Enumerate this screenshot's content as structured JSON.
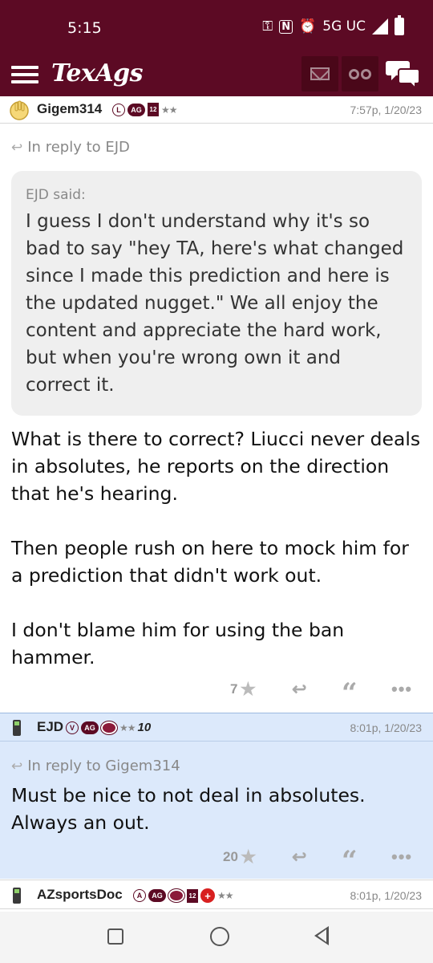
{
  "status_bar": {
    "time": "5:15",
    "network": "5G UC"
  },
  "app_bar": {
    "title": "TexAgs",
    "icons": [
      "menu-icon",
      "mail-icon",
      "binoculars-icon",
      "chat-icon"
    ]
  },
  "posts": [
    {
      "username": "Gigem314",
      "badges": [
        "L",
        "AG",
        "12",
        "★★"
      ],
      "timestamp": "7:57p, 1/20/23",
      "reply_to": "In reply to EJD",
      "quote": {
        "author": "EJD said:",
        "text": "I guess I don't understand why it's so bad to say \"hey TA, here's what changed since I made this prediction and here is the updated nugget.\" We all enjoy the content and appreciate the hard work, but when you're wrong own it and correct it."
      },
      "paragraphs": [
        "What is there to correct? Liucci never deals in absolutes, he reports on the direction that he's hearing.",
        "Then people rush on here to mock him for a prediction that didn't work out.",
        "I don't blame him for using the ban hammer."
      ],
      "likes": "7"
    },
    {
      "username": "EJD",
      "badges": [
        "V",
        "AG",
        "★★",
        "10"
      ],
      "timestamp": "8:01p, 1/20/23",
      "reply_to": "In reply to Gigem314",
      "paragraphs": [
        "Must be nice to not deal in absolutes. Always an out."
      ],
      "likes": "20",
      "highlighted": true,
      "highlight_color": "#dce9fb"
    },
    {
      "username": "AZsportsDoc",
      "badges": [
        "A",
        "AG",
        "12",
        "+",
        "★★"
      ],
      "timestamp": "8:01p, 1/20/23"
    }
  ],
  "colors": {
    "brand": "#5c0a24",
    "highlight": "#dce9fb"
  }
}
